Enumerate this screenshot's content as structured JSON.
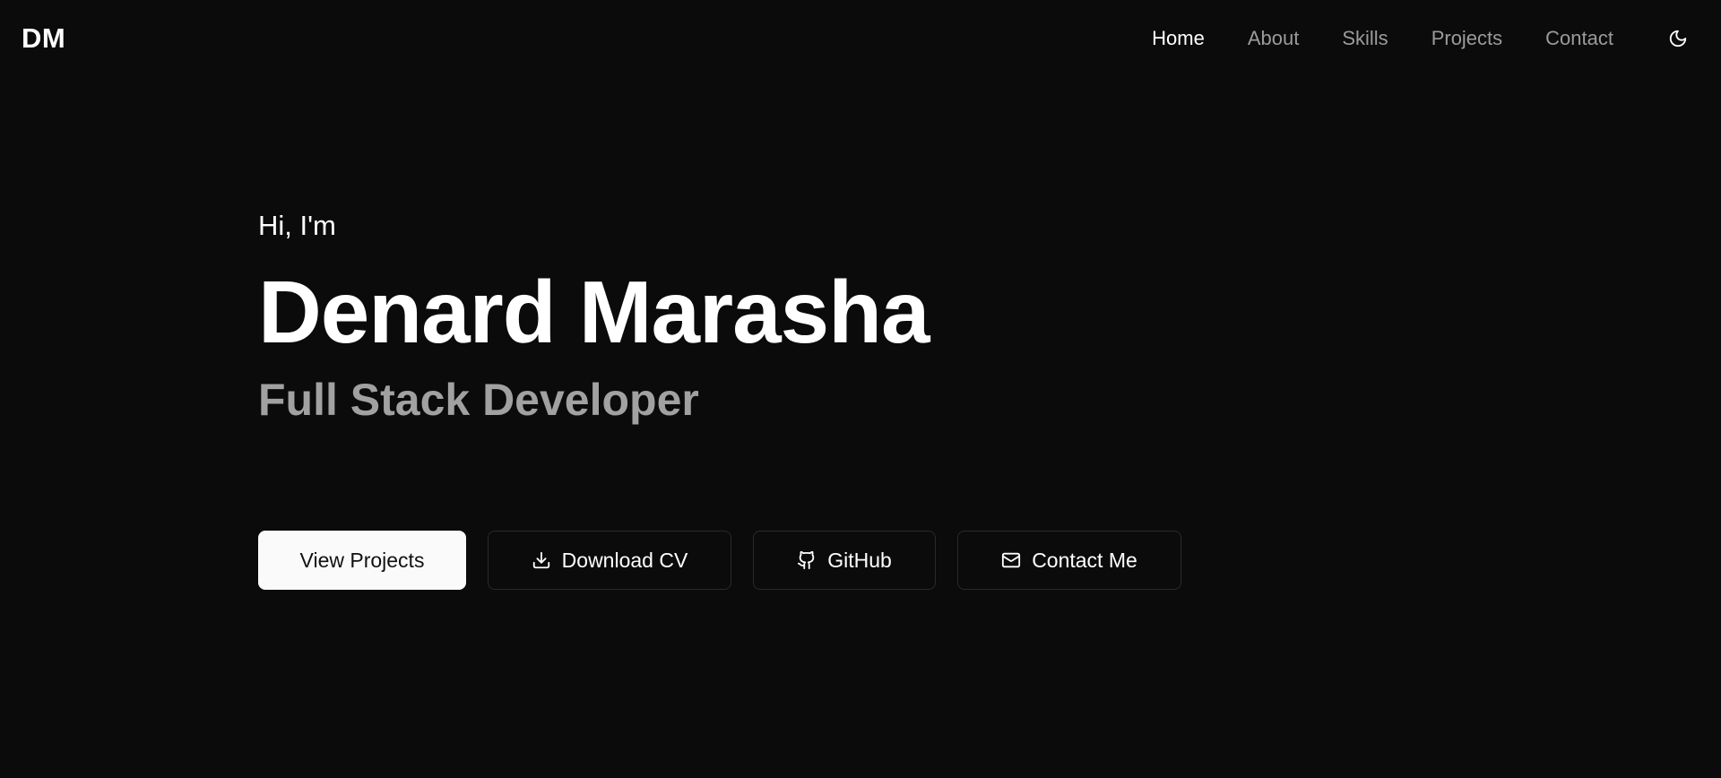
{
  "nav": {
    "logo": "DM",
    "links": [
      {
        "label": "Home",
        "active": true
      },
      {
        "label": "About",
        "active": false
      },
      {
        "label": "Skills",
        "active": false
      },
      {
        "label": "Projects",
        "active": false
      },
      {
        "label": "Contact",
        "active": false
      }
    ],
    "theme_icon": "moon-icon"
  },
  "hero": {
    "greeting": "Hi, I'm",
    "name": "Denard Marasha",
    "role": "Full Stack Developer"
  },
  "actions": {
    "view_projects": "View Projects",
    "download_cv": "Download CV",
    "github": "GitHub",
    "contact_me": "Contact Me"
  },
  "icons": {
    "download": "download-icon",
    "github": "github-icon",
    "mail": "mail-icon"
  },
  "colors": {
    "background": "#0b0b0b",
    "text_primary": "#ffffff",
    "text_muted": "#a1a1a1",
    "nav_inactive": "#9b9b9b",
    "button_primary_bg": "#fafafa",
    "button_border": "#2a2a2a"
  }
}
